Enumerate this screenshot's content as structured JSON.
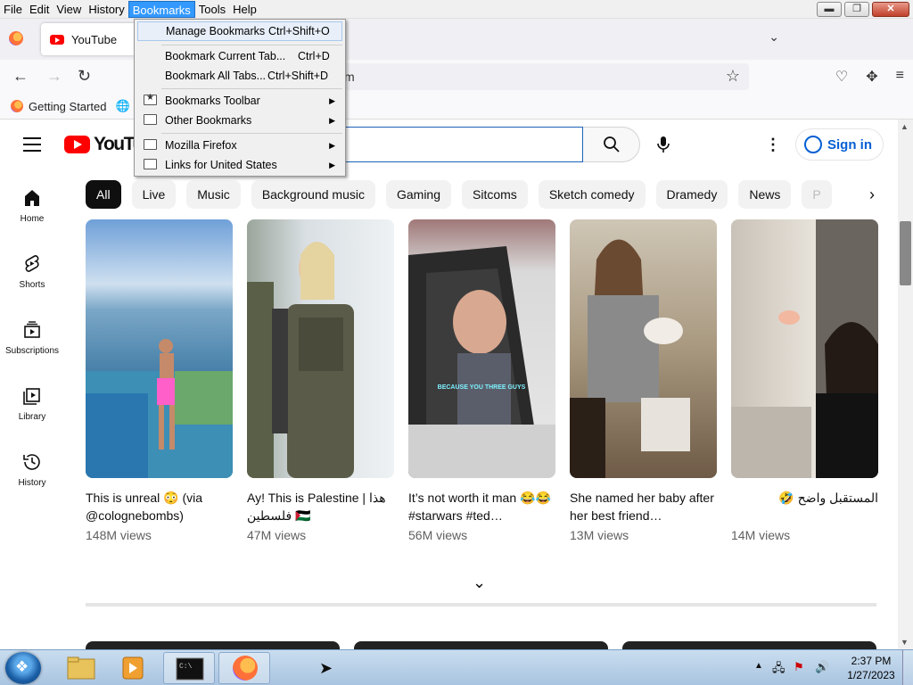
{
  "menubar": {
    "items": [
      "File",
      "Edit",
      "View",
      "History",
      "Bookmarks",
      "Tools",
      "Help"
    ],
    "active": "Bookmarks",
    "window_controls": [
      "minimize",
      "restore",
      "close"
    ]
  },
  "tabs": {
    "active_tab_title": "YouTube"
  },
  "navbar": {
    "url_fragment": "m"
  },
  "bookmarks_toolbar": {
    "items": [
      "Getting Started",
      "W"
    ]
  },
  "bookmarks_menu": {
    "items": [
      {
        "label": "Manage Bookmarks",
        "shortcut": "Ctrl+Shift+O",
        "highlighted": true
      },
      {
        "label": "Bookmark Current Tab...",
        "shortcut": "Ctrl+D"
      },
      {
        "label": "Bookmark All Tabs...",
        "shortcut": "Ctrl+Shift+D"
      },
      {
        "label": "Bookmarks Toolbar",
        "submenu": true,
        "icon": "bookmarks-toolbar-icon"
      },
      {
        "label": "Other Bookmarks",
        "submenu": true,
        "icon": "folder-icon"
      },
      {
        "label": "Mozilla Firefox",
        "submenu": true,
        "icon": "folder-icon"
      },
      {
        "label": "Links for United States",
        "submenu": true,
        "icon": "folder-icon"
      }
    ]
  },
  "youtube": {
    "logo_text": "YouTube",
    "sign_in": "Sign in",
    "sidebar": [
      "Home",
      "Shorts",
      "Subscriptions",
      "Library",
      "History"
    ],
    "chips": [
      "All",
      "Live",
      "Music",
      "Background music",
      "Gaming",
      "Sitcoms",
      "Sketch comedy",
      "Dramedy",
      "News",
      "P"
    ],
    "shorts": [
      {
        "title": "This is unreal 😳 (via @colognebombs)",
        "views": "148M views"
      },
      {
        "title": "Ay! This is Palestine | هذا فلسطين 🇵🇸",
        "views": "47M views"
      },
      {
        "title": "It’s not worth it man 😂😂 #starwars #ted…",
        "views": "56M views"
      },
      {
        "title": "She named her baby after her best friend…",
        "views": "13M views"
      },
      {
        "title": "المستقبل واضح 🤣",
        "views": "14M views"
      }
    ],
    "thumb_caption_3": "BECAUSE YOU THREE GUYS"
  },
  "taskbar": {
    "time": "2:37 PM",
    "date": "1/27/2023"
  },
  "colors": {
    "youtube_red": "#ff0000",
    "link_blue": "#065fd4",
    "menu_highlight": "#3399ff"
  }
}
